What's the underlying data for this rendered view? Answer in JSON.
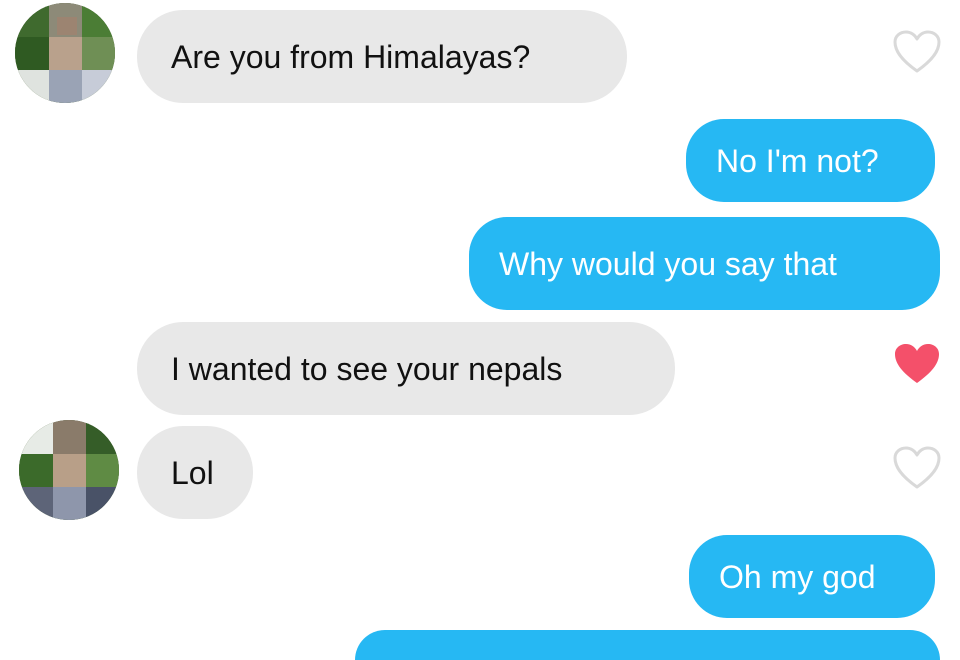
{
  "colors": {
    "incoming_bubble": "#e8e8e8",
    "outgoing_bubble": "#26b8f3",
    "heart_liked": "#f4506a",
    "heart_unliked": "#d9d9d9"
  },
  "messages": [
    {
      "id": "m1",
      "direction": "incoming",
      "text": "Are you from Himalayas?",
      "liked": false,
      "icon": "heart-outline-icon"
    },
    {
      "id": "m2",
      "direction": "outgoing",
      "text": "No I'm not?"
    },
    {
      "id": "m3",
      "direction": "outgoing",
      "text": "Why would you say that"
    },
    {
      "id": "m4",
      "direction": "incoming",
      "text": "I wanted to see your nepals",
      "liked": true,
      "icon": "heart-filled-icon"
    },
    {
      "id": "m5",
      "direction": "incoming",
      "text": "Lol",
      "liked": false,
      "icon": "heart-outline-icon"
    },
    {
      "id": "m6",
      "direction": "outgoing",
      "text": "Oh my god"
    }
  ]
}
